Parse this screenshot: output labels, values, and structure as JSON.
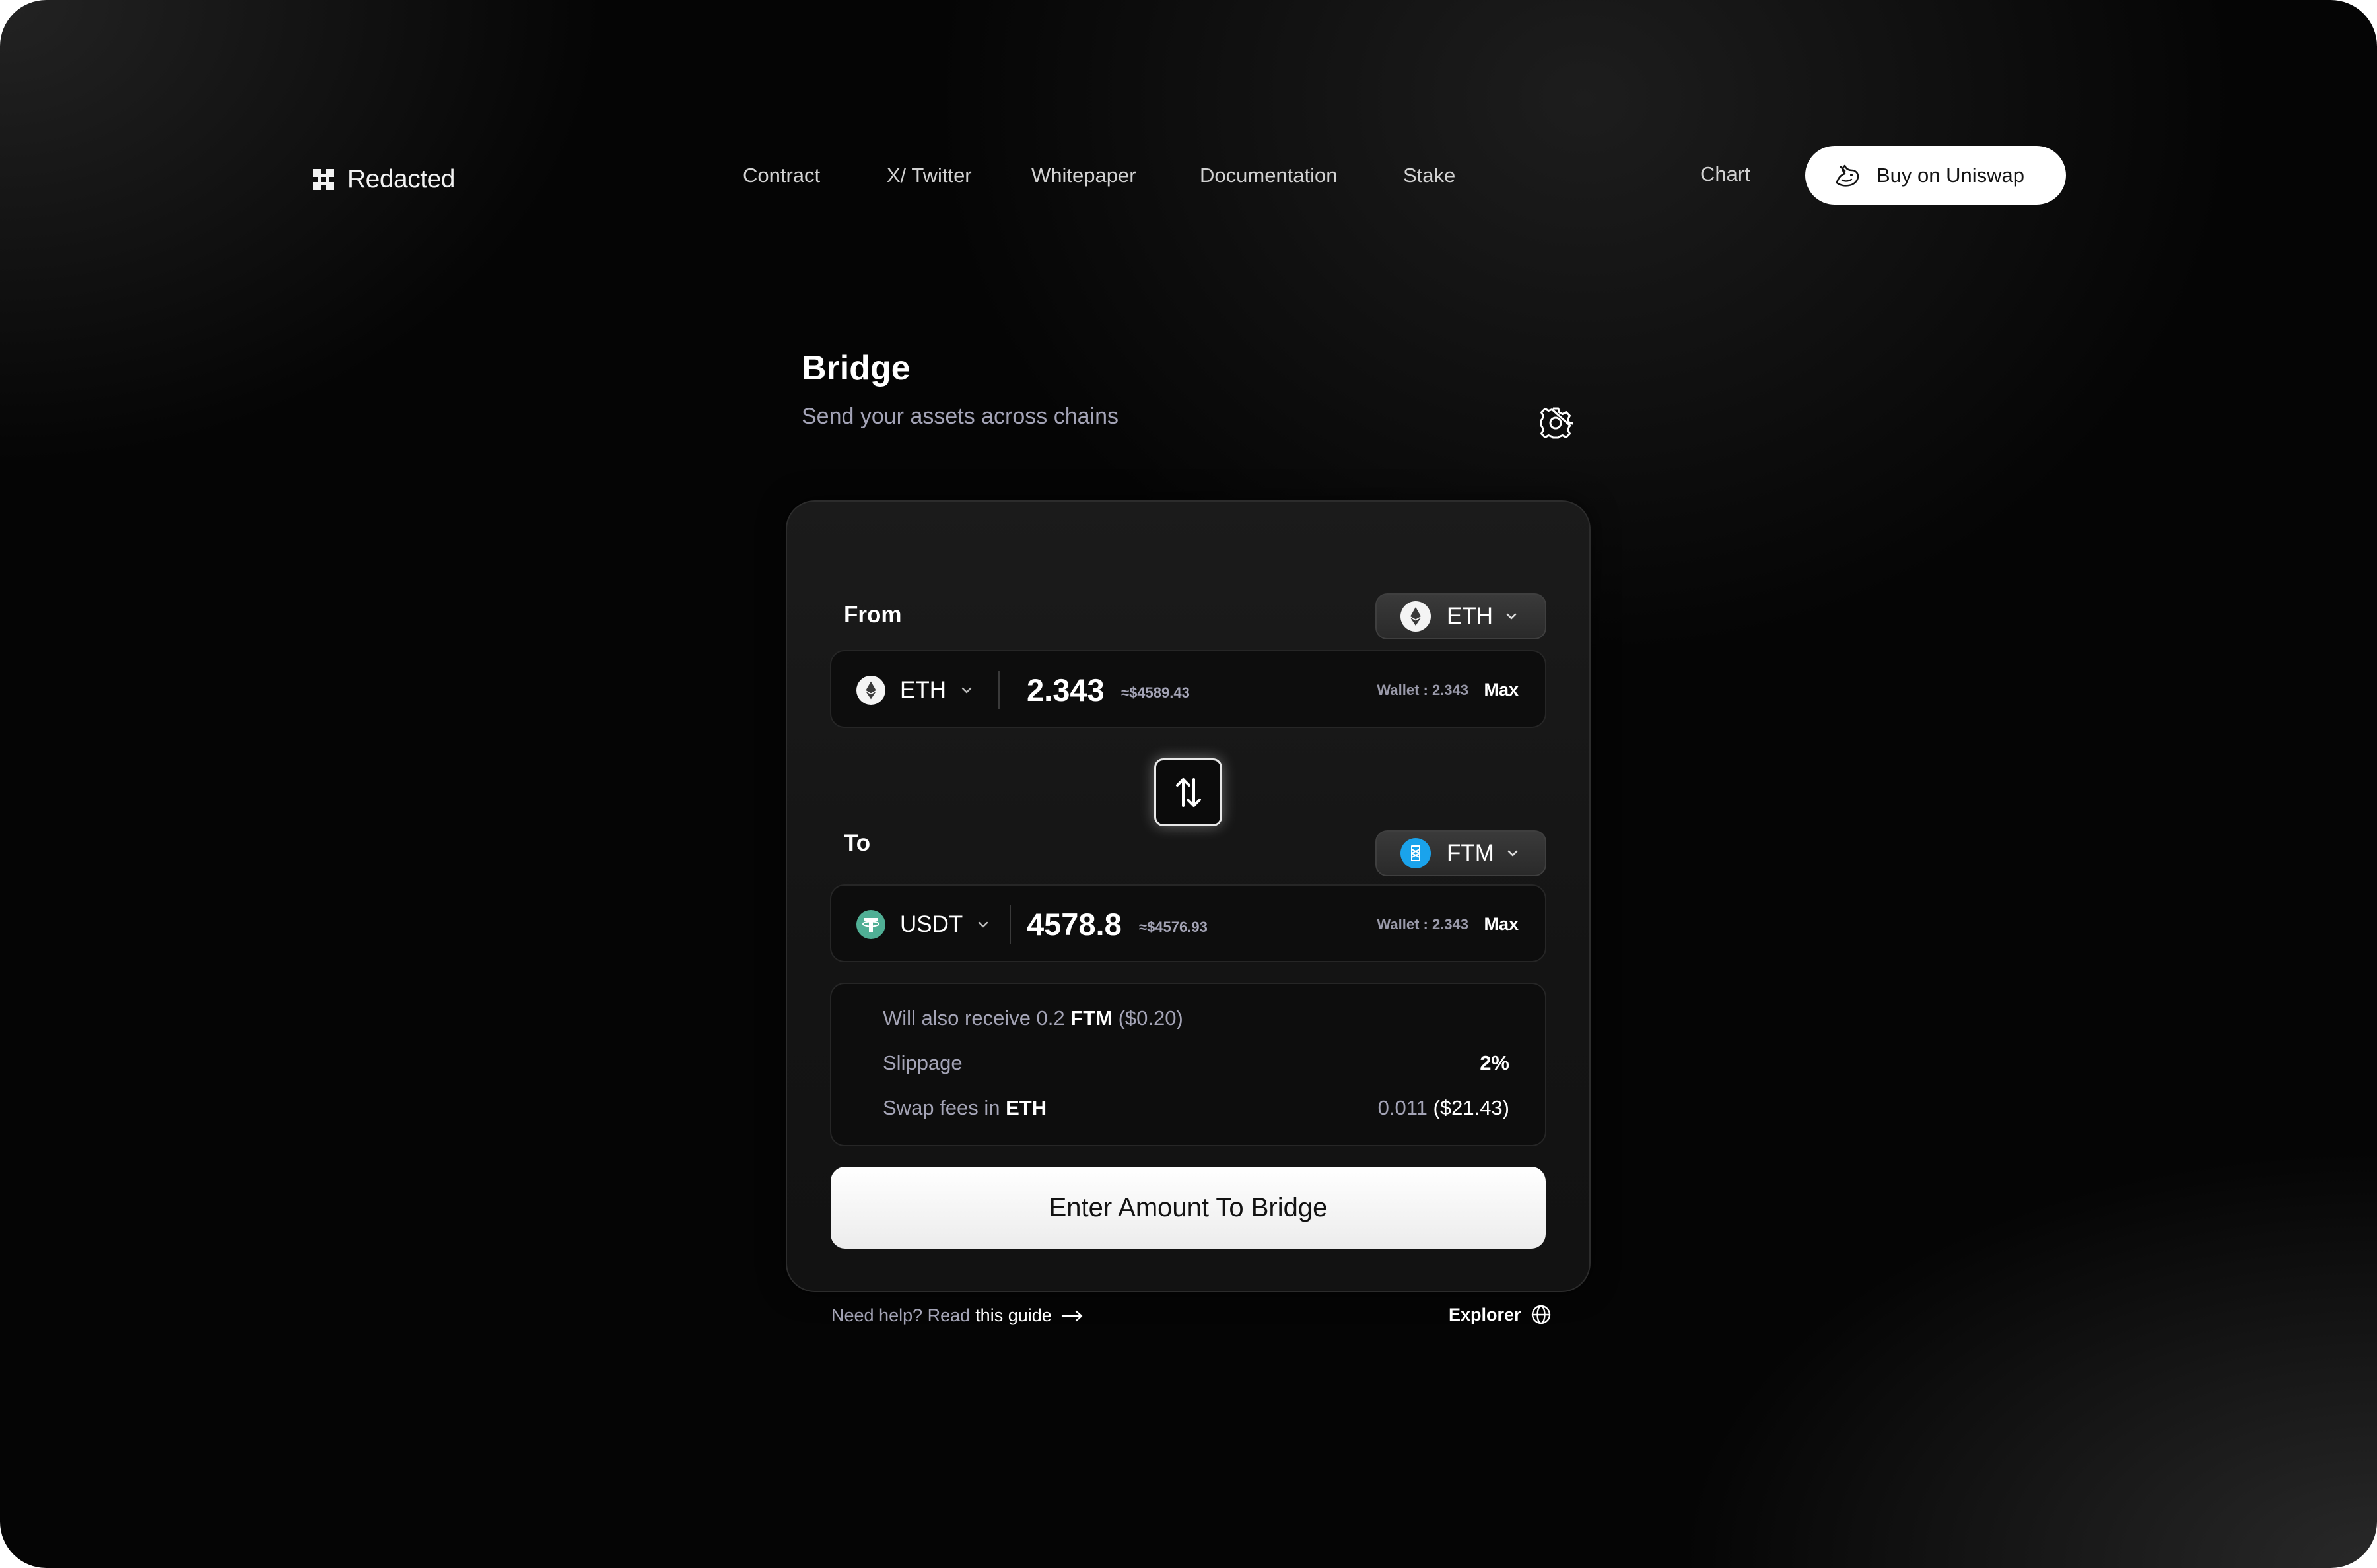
{
  "brand": {
    "name": "Redacted"
  },
  "nav": {
    "links": [
      "Contract",
      "X/ Twitter",
      "Whitepaper",
      "Documentation",
      "Stake"
    ],
    "chart": "Chart",
    "cta": "Buy on Uniswap"
  },
  "header": {
    "title": "Bridge",
    "subtitle": "Send your assets across chains"
  },
  "from": {
    "label": "From",
    "chain": "ETH",
    "token": "ETH",
    "amount": "2.343",
    "usd": "≈$4589.43",
    "wallet": "Wallet : 2.343",
    "max": "Max"
  },
  "to": {
    "label": "To",
    "chain": "FTM",
    "token": "USDT",
    "amount": "4578.8",
    "usd": "≈$4576.93",
    "wallet": "Wallet : 2.343",
    "max": "Max"
  },
  "info": {
    "receive_prefix": "Will also receive 0.2",
    "receive_token": "FTM",
    "receive_usd": "($0.20)",
    "slippage_label": "Slippage",
    "slippage_value": "2%",
    "fees_prefix": "Swap fees in",
    "fees_token": "ETH",
    "fees_amount": "0.011",
    "fees_usd": "($21.43)"
  },
  "action": {
    "bridge_label": "Enter Amount To Bridge"
  },
  "footer": {
    "help_prefix": "Need help? Read",
    "help_link": "this guide",
    "explorer": "Explorer"
  },
  "icons": {
    "logo": "redacted-logo-icon",
    "uniswap": "uniswap-unicorn-icon",
    "settings": "gear-icon",
    "eth": "ethereum-icon",
    "ftm": "fantom-icon",
    "usdt": "tether-icon",
    "swap": "swap-arrows-icon",
    "arrow": "arrow-right-icon",
    "globe": "globe-icon"
  },
  "colors": {
    "background": "#050505",
    "card": "#171717",
    "muted_text": "#a4a4b6",
    "usdt_green": "#50af95",
    "ftm_blue": "#1aa3ec",
    "button_bg": "#ffffff"
  }
}
